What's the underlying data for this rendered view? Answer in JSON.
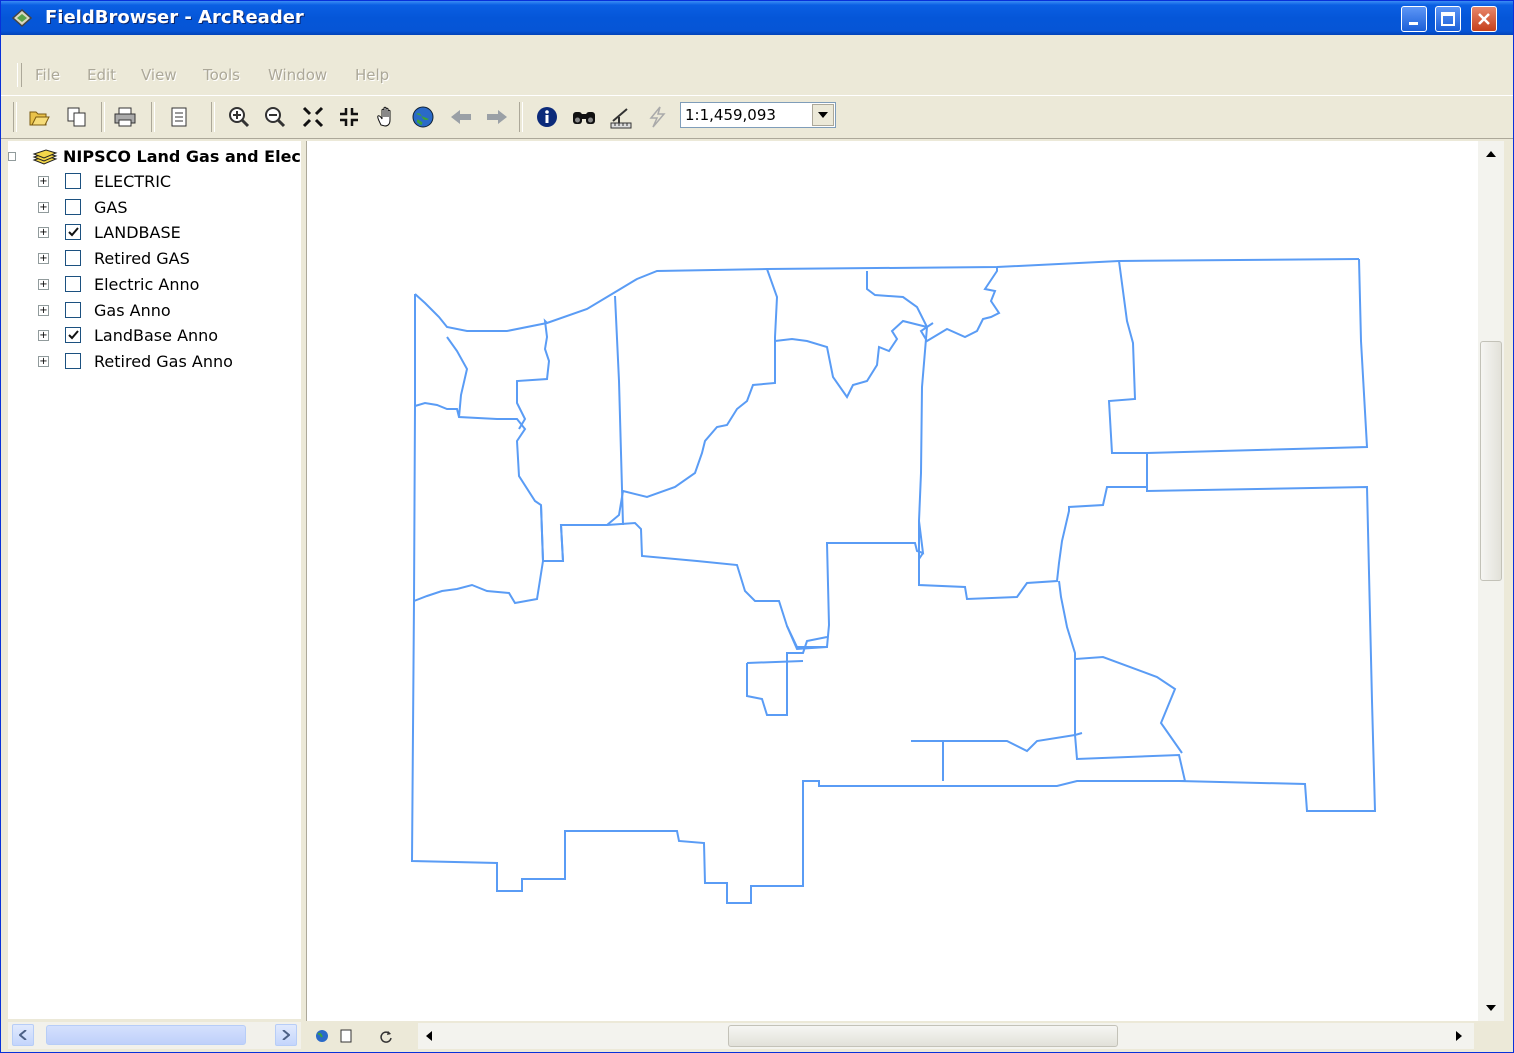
{
  "window": {
    "title": "FieldBrowser - ArcReader"
  },
  "menu": [
    "File",
    "Edit",
    "View",
    "Tools",
    "Window",
    "Help"
  ],
  "toolbar": {
    "scale": "1:1,459,093",
    "icons": [
      "open-icon",
      "copy-icon",
      "print-icon",
      "page-layout-icon",
      "zoom-in-icon",
      "zoom-out-icon",
      "fixed-zoom-in-icon",
      "fixed-zoom-out-icon",
      "pan-icon",
      "full-extent-icon",
      "back-icon",
      "forward-icon",
      "identify-icon",
      "find-icon",
      "measure-icon",
      "hyperlink-icon"
    ]
  },
  "toc": {
    "root_label": "NIPSCO Land Gas and Elec",
    "layers": [
      {
        "label": "ELECTRIC",
        "checked": false
      },
      {
        "label": "GAS",
        "checked": false
      },
      {
        "label": "LANDBASE",
        "checked": true
      },
      {
        "label": "Retired GAS",
        "checked": false
      },
      {
        "label": "Electric Anno",
        "checked": false
      },
      {
        "label": "Gas Anno",
        "checked": false
      },
      {
        "label": "LandBase Anno",
        "checked": true
      },
      {
        "label": "Retired Gas Anno",
        "checked": false
      }
    ]
  },
  "colors": {
    "boundary": "#5a9cf5",
    "titlebar": "#0556d8"
  }
}
